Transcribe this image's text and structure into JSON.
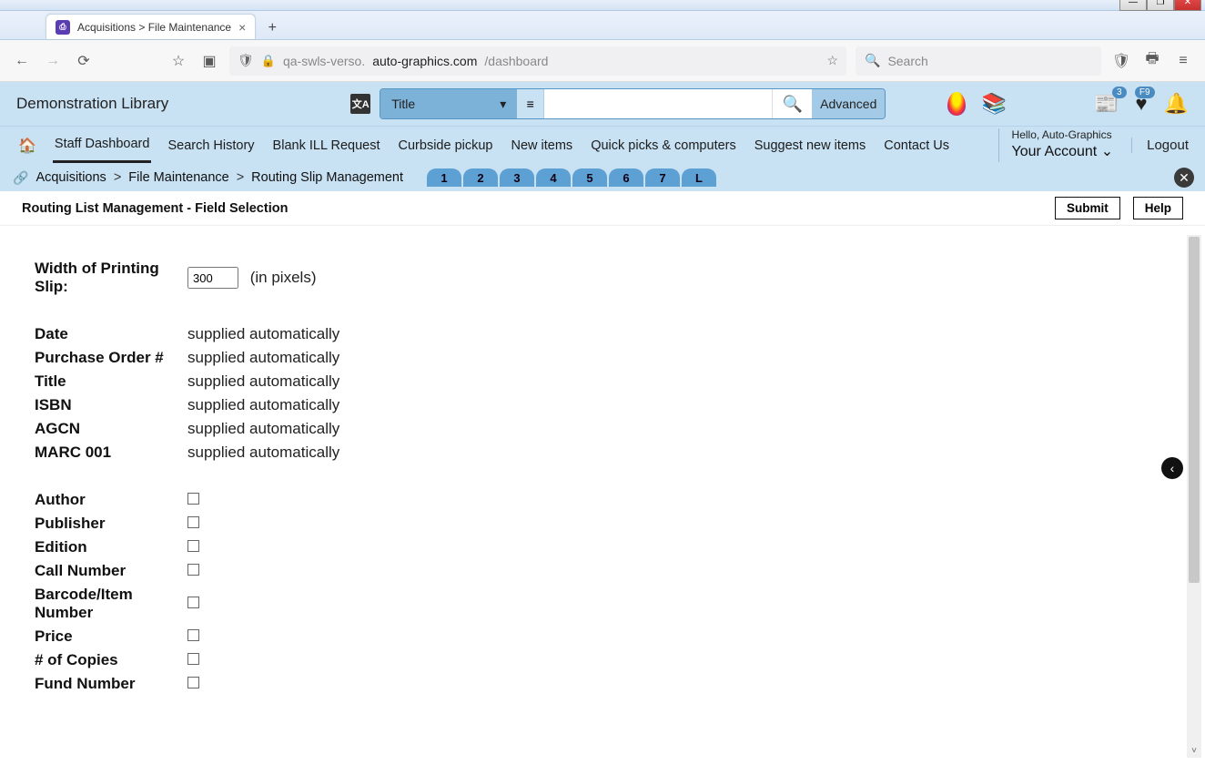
{
  "window": {
    "tab_title": "Acquisitions > File Maintenance"
  },
  "browser": {
    "url_prefix": "qa-swls-verso.",
    "url_domain": "auto-graphics.com",
    "url_path": "/dashboard",
    "search_placeholder": "Search"
  },
  "header": {
    "library_name": "Demonstration Library",
    "search_scope": "Title",
    "advanced": "Advanced",
    "badge_news": "3",
    "badge_fav": "F9"
  },
  "nav": {
    "items": [
      "Staff Dashboard",
      "Search History",
      "Blank ILL Request",
      "Curbside pickup",
      "New items",
      "Quick picks & computers",
      "Suggest new items",
      "Contact Us"
    ],
    "hello": "Hello, Auto-Graphics",
    "account": "Your Account",
    "logout": "Logout"
  },
  "breadcrumb": {
    "a": "Acquisitions",
    "b": "File Maintenance",
    "c": "Routing Slip Management",
    "tabs": [
      "1",
      "2",
      "3",
      "4",
      "5",
      "6",
      "7",
      "L"
    ]
  },
  "page": {
    "title": "Routing List Management - Field Selection",
    "submit": "Submit",
    "help": "Help"
  },
  "form": {
    "width_label": "Width of Printing Slip:",
    "width_value": "300",
    "width_suffix": "(in pixels)",
    "auto_rows": [
      {
        "label": "Date",
        "value": "supplied automatically"
      },
      {
        "label": "Purchase Order #",
        "value": "supplied automatically"
      },
      {
        "label": "Title",
        "value": "supplied automatically"
      },
      {
        "label": "ISBN",
        "value": "supplied automatically"
      },
      {
        "label": "AGCN",
        "value": "supplied automatically"
      },
      {
        "label": "MARC 001",
        "value": "supplied automatically"
      }
    ],
    "check_rows": [
      "Author",
      "Publisher",
      "Edition",
      "Call Number",
      "Barcode/Item Number",
      "Price",
      "# of Copies",
      "Fund Number"
    ]
  }
}
